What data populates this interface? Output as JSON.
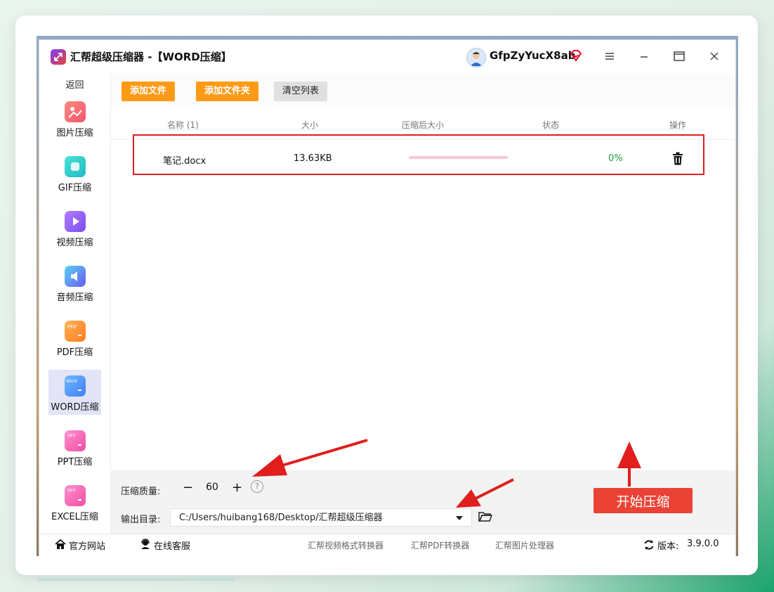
{
  "app": {
    "title": "汇帮超级压缩器 -【WORD压缩】",
    "username": "GfpZyYucX8ab"
  },
  "sidebar": {
    "back_label": "返回",
    "items": [
      {
        "label": "图片压缩",
        "icon": "image-icon",
        "color": "#f0566d",
        "active": false
      },
      {
        "label": "GIF压缩",
        "icon": "gif-icon",
        "color": "#2ad0c7",
        "active": false
      },
      {
        "label": "视频压缩",
        "icon": "video-icon",
        "color": "#8c5df2",
        "active": false
      },
      {
        "label": "音频压缩",
        "icon": "audio-icon",
        "color": "#4b8cf5",
        "active": false
      },
      {
        "label": "PDF压缩",
        "icon": "pdf-icon",
        "color": "#ff8a2b",
        "active": false
      },
      {
        "label": "WORD压缩",
        "icon": "word-icon",
        "color": "#3f8af5",
        "active": true
      },
      {
        "label": "PPT压缩",
        "icon": "ppt-icon",
        "color": "#f25aa5",
        "active": false
      },
      {
        "label": "EXCEL压缩",
        "icon": "excel-icon",
        "color": "#f25aa5",
        "active": false
      }
    ]
  },
  "toolbar": {
    "add_file_label": "添加文件",
    "add_folder_label": "添加文件夹",
    "clear_list_label": "清空列表"
  },
  "table": {
    "headers": {
      "name": "名称 (1)",
      "size": "大小",
      "compressed_size": "压缩后大小",
      "status": "状态",
      "action": "操作"
    },
    "rows": [
      {
        "name": "笔记.docx",
        "size": "13.63KB",
        "compressed_size": "-",
        "progress": 0,
        "percent_label": "0%"
      }
    ]
  },
  "settings": {
    "quality_label": "压缩质量:",
    "quality_value": "60",
    "minus_label": "−",
    "plus_label": "+",
    "help_label": "?",
    "output_label": "输出目录:",
    "output_path": "C:/Users/huibang168/Desktop/汇帮超级压缩器",
    "start_label": "开始压缩"
  },
  "statusbar": {
    "website_label": "官方网站",
    "support_label": "在线客服",
    "links": [
      "汇帮视频格式转换器",
      "汇帮PDF转换器",
      "汇帮图片处理器"
    ],
    "version_label": "版本:",
    "version_value": "3.9.0.0"
  },
  "colors": {
    "accent_orange": "#ff9a16",
    "start_red": "#ea4335",
    "annotation_red": "#e01e1e",
    "progress_pink": "#f6c8d4",
    "percent_green": "#1a9e3a"
  }
}
